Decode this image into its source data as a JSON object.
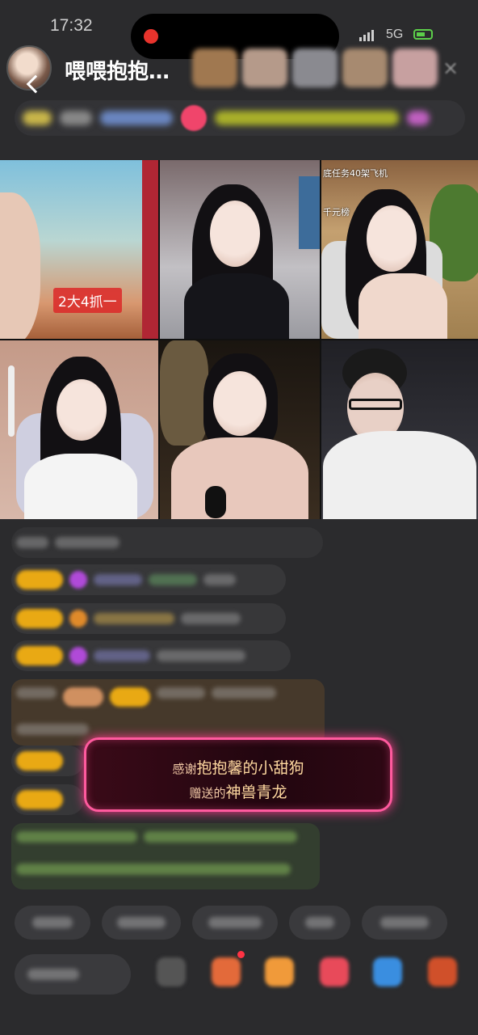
{
  "status": {
    "time": "17:32",
    "network": "5G",
    "battery_color": "#5ccf4a",
    "recording_color": "#e8332c"
  },
  "header": {
    "host_name": "喂喂抱抱…",
    "back_icon": "chevron-left-icon",
    "close_icon": "close-icon",
    "close_glyph": "×"
  },
  "video": {
    "cell1_label": "2大4抓一",
    "cell3_overlay_top": "底任务40架飞机",
    "cell3_overlay_sub": "千元榜"
  },
  "gift": {
    "thanks": "感谢",
    "sender": "抱抱馨的小甜狗",
    "sent": "赠送的",
    "gift_name": "神兽青龙",
    "border_color": "#ff5a9e"
  }
}
